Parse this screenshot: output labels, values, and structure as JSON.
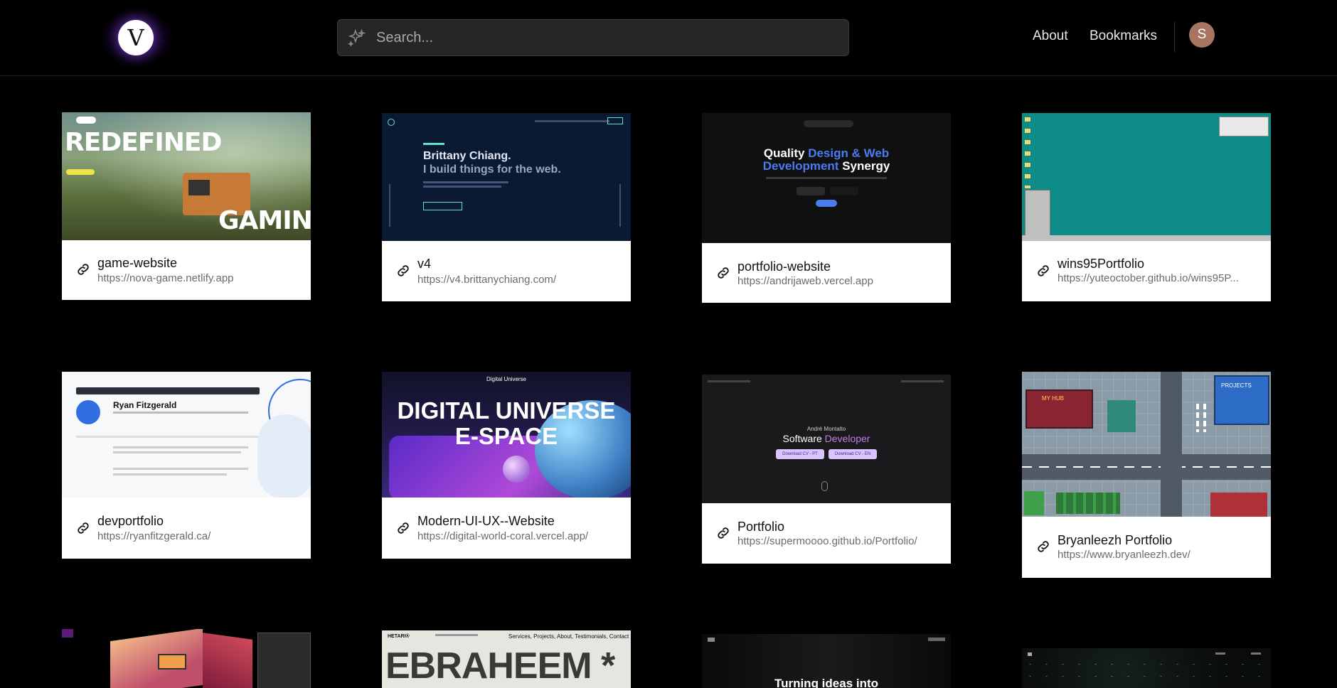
{
  "header": {
    "logo_letter": "V",
    "search_placeholder": "Search...",
    "nav": {
      "about": "About",
      "bookmarks": "Bookmarks"
    },
    "avatar_initial": "S"
  },
  "cards": [
    {
      "title": "game-website",
      "url": "https://nova-game.netlify.app",
      "preview": {
        "headline": "REDEFINED",
        "subheadline": "GAMING"
      }
    },
    {
      "title": "v4",
      "url": "https://v4.brittanychiang.com/",
      "preview": {
        "line1": "Brittany Chiang.",
        "line2": "I build things for the web."
      }
    },
    {
      "title": "portfolio-website",
      "url": "https://andrijaweb.vercel.app",
      "preview": {
        "q1": "Quality ",
        "q2": "Design & Web",
        "q3": "Development",
        "q4": " Synergy"
      }
    },
    {
      "title": "wins95Portfolio",
      "url": "https://yuteoctober.github.io/wins95P..."
    },
    {
      "title": "devportfolio",
      "url": "https://ryanfitzgerald.ca/",
      "preview": {
        "name": "Ryan Fitzgerald"
      }
    },
    {
      "title": "Modern-UI-UX--Website",
      "url": "https://digital-world-coral.vercel.app/",
      "preview": {
        "brand": "Digital Universe",
        "line1": "DIGITAL UNIVERSE",
        "line2": "E-SPACE"
      }
    },
    {
      "title": "Portfolio",
      "url": "https://supermoooo.github.io/Portfolio/",
      "preview": {
        "name": "André Montalto",
        "role1": "Software ",
        "role2": "Developer",
        "btn1": "Download CV - PT",
        "btn2": "Download CV - EN"
      }
    },
    {
      "title": "Bryanleezh Portfolio",
      "url": "https://www.bryanleezh.dev/",
      "preview": {
        "sign1": "MY HUB",
        "sign2": "PROJECTS"
      }
    },
    {
      "title": "",
      "url": ""
    },
    {
      "title": "",
      "url": "",
      "preview": {
        "brand": "HETARI®",
        "nav": "Services, Projects, About, Testimonials, Contact",
        "big": "EBRAHEEM *"
      }
    },
    {
      "title": "",
      "url": "",
      "preview": {
        "text": "Turning ideas into"
      }
    },
    {
      "title": "",
      "url": ""
    }
  ],
  "colors": {
    "accent": "#8c3cff",
    "link_gray": "#6b6b6b",
    "search_bg": "#262626"
  },
  "icons": [
    "sparkle-icon",
    "link-icon"
  ]
}
